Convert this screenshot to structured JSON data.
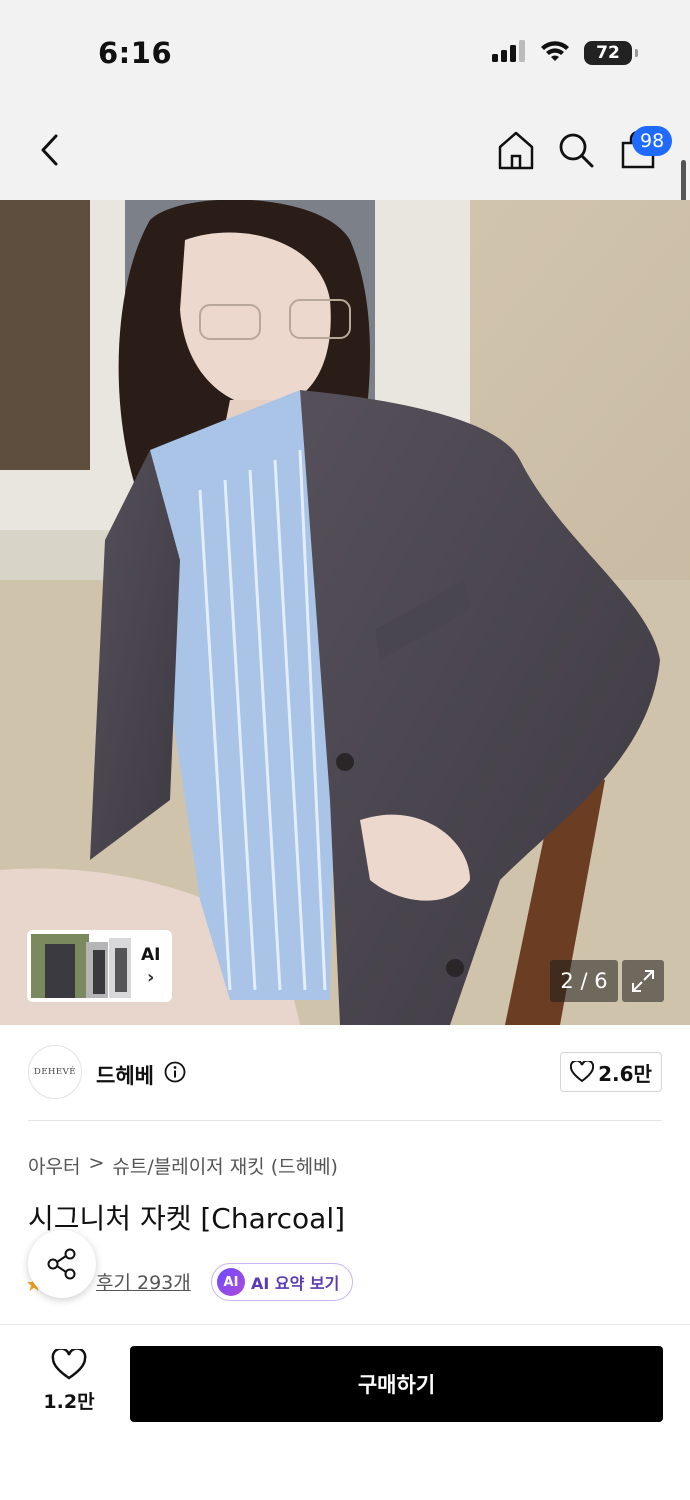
{
  "status_bar": {
    "time": "6:16",
    "battery": "72",
    "icons": [
      "cellular-signal-icon",
      "wifi-icon",
      "battery-icon"
    ]
  },
  "nav": {
    "icons": [
      "chevron-left-icon",
      "home-icon",
      "search-icon",
      "shopping-bag-icon"
    ],
    "bag_count": "98"
  },
  "gallery": {
    "ai_thumb_label": "AI",
    "ai_thumb_arrow": "›",
    "counter": "2 / 6",
    "current": 2,
    "total": 6
  },
  "brand": {
    "logo_text": "DEHEVÉ",
    "name": "드헤베",
    "likes": "2.6만"
  },
  "product": {
    "breadcrumb": [
      "아우터",
      "슈트/블레이저 재킷 (드헤베)"
    ],
    "breadcrumb_separator": ">",
    "title": "시그니처 자켓 [Charcoal]",
    "reviews": "후기 293개",
    "ai_badge": "AI",
    "ai_summary": "AI 요약 보기"
  },
  "bottom_bar": {
    "wish_count": "1.2만",
    "buy_label": "구매하기"
  },
  "colors": {
    "accent_badge": "#1f6bff",
    "buy_button": "#000000",
    "ai_purple": "#6a4bff"
  }
}
